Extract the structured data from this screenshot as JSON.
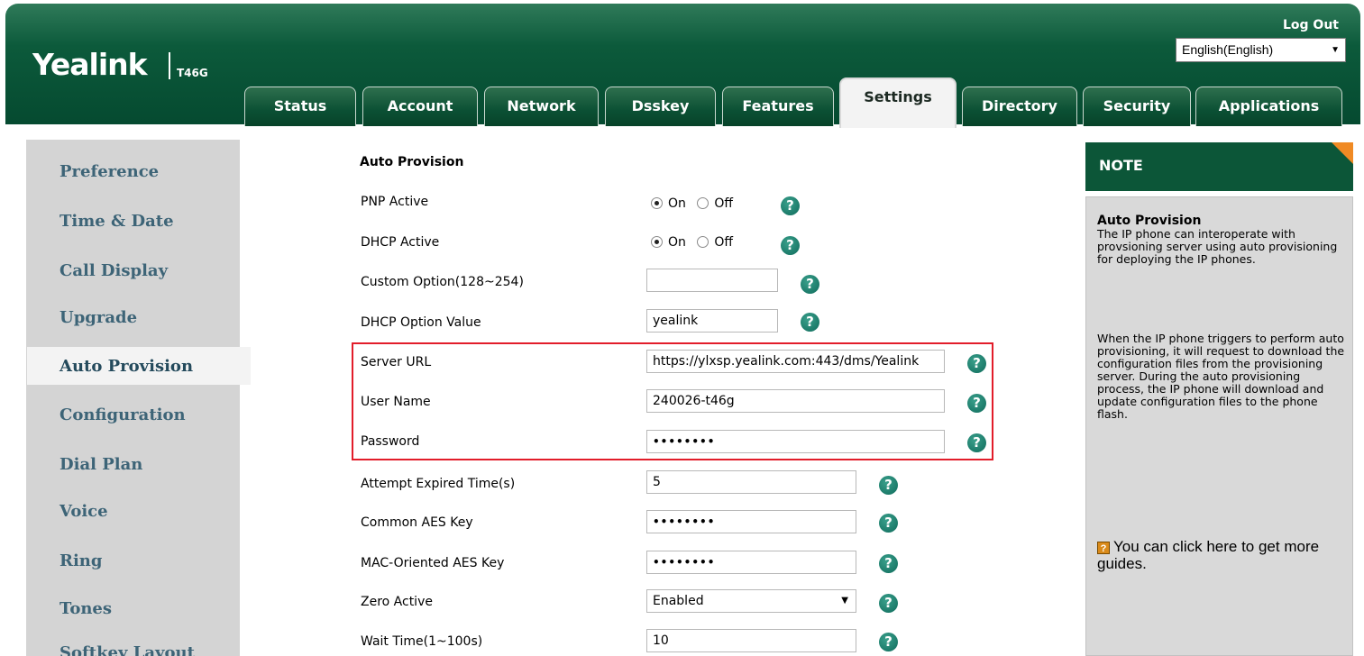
{
  "header": {
    "logo": "Yealink",
    "model": "T46G",
    "logout": "Log Out",
    "language": "English(English)"
  },
  "tabs": [
    "Status",
    "Account",
    "Network",
    "Dsskey",
    "Features",
    "Settings",
    "Directory",
    "Security",
    "Applications"
  ],
  "active_tab": "Settings",
  "nav": {
    "items": [
      "Preference",
      "Time & Date",
      "Call Display",
      "Upgrade",
      "Auto Provision",
      "Configuration",
      "Dial Plan",
      "Voice",
      "Ring",
      "Tones",
      "Softkey Layout"
    ],
    "active": "Auto Provision"
  },
  "form": {
    "section_title": "Auto Provision",
    "pnp_active": {
      "label": "PNP Active",
      "on": "On",
      "off": "Off",
      "value": "On"
    },
    "dhcp_active": {
      "label": "DHCP Active",
      "on": "On",
      "off": "Off",
      "value": "On"
    },
    "custom_option": {
      "label": "Custom Option(128~254)",
      "value": ""
    },
    "dhcp_option_value": {
      "label": "DHCP Option Value",
      "value": "yealink"
    },
    "server_url": {
      "label": "Server URL",
      "value": "https://ylxsp.yealink.com:443/dms/Yealink"
    },
    "user_name": {
      "label": "User Name",
      "value": "240026-t46g"
    },
    "password": {
      "label": "Password",
      "value": "••••••••"
    },
    "attempt_expired_time": {
      "label": "Attempt Expired Time(s)",
      "value": "5"
    },
    "common_aes_key": {
      "label": "Common AES Key",
      "value": "••••••••"
    },
    "mac_aes_key": {
      "label": "MAC-Oriented AES Key",
      "value": "••••••••"
    },
    "zero_active": {
      "label": "Zero Active",
      "value": "Enabled"
    },
    "wait_time": {
      "label": "Wait Time(1~100s)",
      "value": "10"
    }
  },
  "note": {
    "title": "NOTE",
    "heading": "Auto Provision",
    "p1": "The IP phone can interoperate with provsioning server using auto provisioning for deploying the IP phones.",
    "p2": "When the IP phone triggers to perform auto provisioning, it will request to download the configuration files from the provisioning server. During the auto provisioning process, the IP phone will download and update configuration files to the phone flash.",
    "guide_icon": "?",
    "guide": "You can click here to get more guides."
  },
  "colors": {
    "header_green": "#0c5a3b",
    "nav_text": "#3d6477",
    "help_icon": "#1b7a66",
    "highlight_border": "#e21d2a",
    "note_accent": "#f08a24"
  },
  "icons": {
    "help": "question-circle-icon",
    "dropdown": "chevron-down-icon",
    "guide": "help-square-icon"
  }
}
